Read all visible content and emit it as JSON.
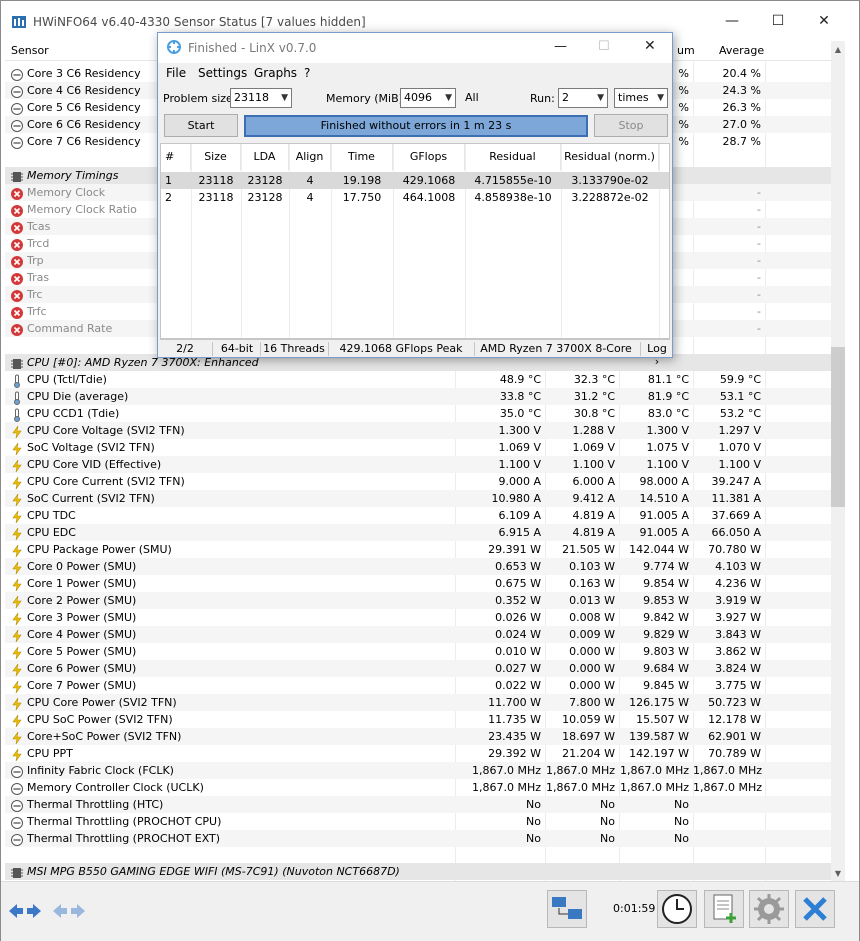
{
  "window": {
    "title": "HWiNFO64 v6.40-4330 Sensor Status [7 values hidden]",
    "minimize": "—",
    "maximize": "☐",
    "close": "✕"
  },
  "headers": {
    "sensor": "Sensor",
    "maximum_partial": "um",
    "average": "Average"
  },
  "top_rows": [
    {
      "name": "Core 3 C6 Residency",
      "max": "%",
      "avg": "20.4 %"
    },
    {
      "name": "Core 4 C6 Residency",
      "max": "%",
      "avg": "24.3 %"
    },
    {
      "name": "Core 5 C6 Residency",
      "max": "%",
      "avg": "26.3 %"
    },
    {
      "name": "Core 6 C6 Residency",
      "max": "%",
      "avg": "27.0 %"
    },
    {
      "name": "Core 7 C6 Residency",
      "max": "%",
      "avg": "28.7 %"
    }
  ],
  "memory_group": {
    "title": "Memory Timings",
    "rows": [
      {
        "name": "Memory Clock",
        "dash": "-"
      },
      {
        "name": "Memory Clock Ratio",
        "dash": "-"
      },
      {
        "name": "Tcas",
        "dash": "-"
      },
      {
        "name": "Trcd",
        "dash": "-"
      },
      {
        "name": "Trp",
        "dash": "-"
      },
      {
        "name": "Tras",
        "dash": "-"
      },
      {
        "name": "Trc",
        "dash": "-"
      },
      {
        "name": "Trfc",
        "dash": "-"
      },
      {
        "name": "Command Rate",
        "dash": "-"
      }
    ]
  },
  "cpu_group": {
    "title": "CPU [#0]: AMD Ryzen 7 3700X: Enhanced",
    "rows": [
      {
        "icon": "thermometer",
        "name": "CPU (Tctl/Tdie)",
        "cur": "48.9 °C",
        "min": "32.3 °C",
        "max": "81.1 °C",
        "avg": "59.9 °C"
      },
      {
        "icon": "thermometer",
        "name": "CPU Die (average)",
        "cur": "33.8 °C",
        "min": "31.2 °C",
        "max": "81.9 °C",
        "avg": "53.1 °C"
      },
      {
        "icon": "thermometer",
        "name": "CPU CCD1 (Tdie)",
        "cur": "35.0 °C",
        "min": "30.8 °C",
        "max": "83.0 °C",
        "avg": "53.2 °C"
      },
      {
        "icon": "bolt",
        "name": "CPU Core Voltage (SVI2 TFN)",
        "cur": "1.300 V",
        "min": "1.288 V",
        "max": "1.300 V",
        "avg": "1.297 V"
      },
      {
        "icon": "bolt",
        "name": "SoC Voltage (SVI2 TFN)",
        "cur": "1.069 V",
        "min": "1.069 V",
        "max": "1.075 V",
        "avg": "1.070 V"
      },
      {
        "icon": "bolt",
        "name": "CPU Core VID (Effective)",
        "cur": "1.100 V",
        "min": "1.100 V",
        "max": "1.100 V",
        "avg": "1.100 V"
      },
      {
        "icon": "bolt",
        "name": "CPU Core Current (SVI2 TFN)",
        "cur": "9.000 A",
        "min": "6.000 A",
        "max": "98.000 A",
        "avg": "39.247 A"
      },
      {
        "icon": "bolt",
        "name": "SoC Current (SVI2 TFN)",
        "cur": "10.980 A",
        "min": "9.412 A",
        "max": "14.510 A",
        "avg": "11.381 A"
      },
      {
        "icon": "bolt",
        "name": "CPU TDC",
        "cur": "6.109 A",
        "min": "4.819 A",
        "max": "91.005 A",
        "avg": "37.669 A"
      },
      {
        "icon": "bolt",
        "name": "CPU EDC",
        "cur": "6.915 A",
        "min": "4.819 A",
        "max": "91.005 A",
        "avg": "66.050 A"
      },
      {
        "icon": "bolt",
        "name": "CPU Package Power (SMU)",
        "cur": "29.391 W",
        "min": "21.505 W",
        "max": "142.044 W",
        "avg": "70.780 W"
      },
      {
        "icon": "bolt",
        "name": "Core 0 Power (SMU)",
        "cur": "0.653 W",
        "min": "0.103 W",
        "max": "9.774 W",
        "avg": "4.103 W"
      },
      {
        "icon": "bolt",
        "name": "Core 1 Power (SMU)",
        "cur": "0.675 W",
        "min": "0.163 W",
        "max": "9.854 W",
        "avg": "4.236 W"
      },
      {
        "icon": "bolt",
        "name": "Core 2 Power (SMU)",
        "cur": "0.352 W",
        "min": "0.013 W",
        "max": "9.853 W",
        "avg": "3.919 W"
      },
      {
        "icon": "bolt",
        "name": "Core 3 Power (SMU)",
        "cur": "0.026 W",
        "min": "0.008 W",
        "max": "9.842 W",
        "avg": "3.927 W"
      },
      {
        "icon": "bolt",
        "name": "Core 4 Power (SMU)",
        "cur": "0.024 W",
        "min": "0.009 W",
        "max": "9.829 W",
        "avg": "3.843 W"
      },
      {
        "icon": "bolt",
        "name": "Core 5 Power (SMU)",
        "cur": "0.010 W",
        "min": "0.000 W",
        "max": "9.803 W",
        "avg": "3.862 W"
      },
      {
        "icon": "bolt",
        "name": "Core 6 Power (SMU)",
        "cur": "0.027 W",
        "min": "0.000 W",
        "max": "9.684 W",
        "avg": "3.824 W"
      },
      {
        "icon": "bolt",
        "name": "Core 7 Power (SMU)",
        "cur": "0.022 W",
        "min": "0.000 W",
        "max": "9.845 W",
        "avg": "3.775 W"
      },
      {
        "icon": "bolt",
        "name": "CPU Core Power (SVI2 TFN)",
        "cur": "11.700 W",
        "min": "7.800 W",
        "max": "126.175 W",
        "avg": "50.723 W"
      },
      {
        "icon": "bolt",
        "name": "CPU SoC Power (SVI2 TFN)",
        "cur": "11.735 W",
        "min": "10.059 W",
        "max": "15.507 W",
        "avg": "12.178 W"
      },
      {
        "icon": "bolt",
        "name": "Core+SoC Power (SVI2 TFN)",
        "cur": "23.435 W",
        "min": "18.697 W",
        "max": "139.587 W",
        "avg": "62.901 W"
      },
      {
        "icon": "bolt",
        "name": "CPU PPT",
        "cur": "29.392 W",
        "min": "21.204 W",
        "max": "142.197 W",
        "avg": "70.789 W"
      },
      {
        "icon": "clock",
        "name": "Infinity Fabric Clock (FCLK)",
        "cur": "1,867.0 MHz",
        "min": "1,867.0 MHz",
        "max": "1,867.0 MHz",
        "avg": "1,867.0 MHz"
      },
      {
        "icon": "clock",
        "name": "Memory Controller Clock (UCLK)",
        "cur": "1,867.0 MHz",
        "min": "1,867.0 MHz",
        "max": "1,867.0 MHz",
        "avg": "1,867.0 MHz"
      },
      {
        "icon": "clock",
        "name": "Thermal Throttling (HTC)",
        "cur": "No",
        "min": "No",
        "max": "No",
        "avg": ""
      },
      {
        "icon": "clock",
        "name": "Thermal Throttling (PROCHOT CPU)",
        "cur": "No",
        "min": "No",
        "max": "No",
        "avg": ""
      },
      {
        "icon": "clock",
        "name": "Thermal Throttling (PROCHOT EXT)",
        "cur": "No",
        "min": "No",
        "max": "No",
        "avg": ""
      }
    ]
  },
  "mb_group": {
    "title": "MSI MPG B550 GAMING EDGE WIFI (MS-7C91) (Nuvoton NCT6687D)"
  },
  "toolbar": {
    "elapsed": "0:01:59"
  },
  "linx": {
    "title": "Finished - LinX v0.7.0",
    "menu": [
      "File",
      "Settings",
      "Graphs",
      "?"
    ],
    "problem_size_label": "Problem size:",
    "problem_size": "23118",
    "memory_label": "Memory (MiB):",
    "memory": "4096",
    "all": "All",
    "run_label": "Run:",
    "run": "2",
    "times": "times",
    "start": "Start",
    "status": "Finished without errors in 1 m 23 s",
    "stop": "Stop",
    "columns": [
      "#",
      "Size",
      "LDA",
      "Align",
      "Time",
      "GFlops",
      "Residual",
      "Residual (norm.)"
    ],
    "rows": [
      [
        "1",
        "23118",
        "23128",
        "4",
        "19.198",
        "429.1068",
        "4.715855e-10",
        "3.133790e-02"
      ],
      [
        "2",
        "23118",
        "23128",
        "4",
        "17.750",
        "464.1008",
        "4.858938e-10",
        "3.228872e-02"
      ]
    ],
    "statusbar": {
      "progress": "2/2",
      "bits": "64-bit",
      "threads": "16 Threads",
      "peak": "429.1068 GFlops Peak",
      "cpu": "AMD Ryzen 7 3700X 8-Core",
      "log": "Log ›"
    }
  }
}
